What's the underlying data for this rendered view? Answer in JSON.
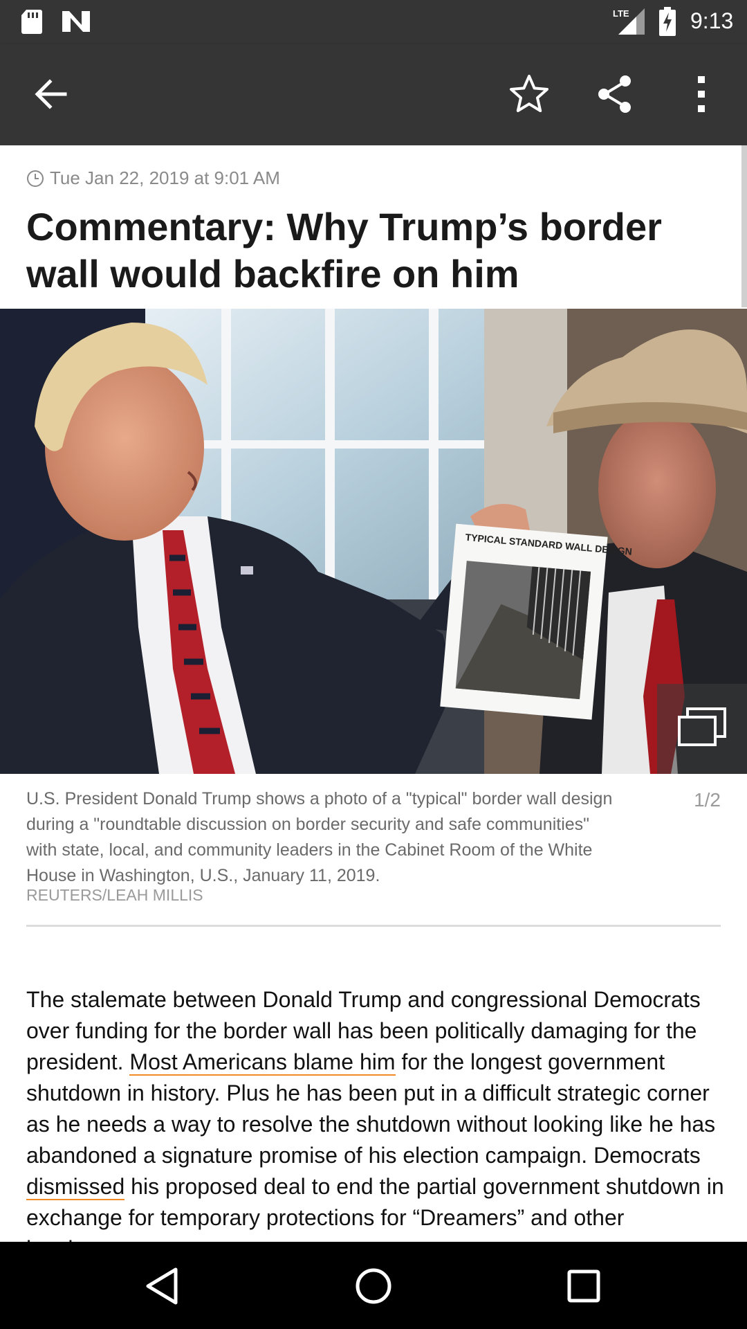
{
  "status_bar": {
    "time": "9:13",
    "network": "LTE"
  },
  "toolbar": {
    "icons": [
      "back-arrow-icon",
      "star-icon",
      "share-icon",
      "more-vert-icon"
    ]
  },
  "article": {
    "date": "Tue Jan 22, 2019 at 9:01 AM",
    "headline": "Commentary: Why Trump’s border wall would backfire on him",
    "photo": {
      "sign_text": "TYPICAL STANDARD WALL DESIGN",
      "counter": "1/2",
      "caption": "U.S. President Donald Trump shows a photo of a \"typical\" border wall design  during a \"roundtable discussion on border security and safe communities\" with state, local, and community leaders in the Cabinet Room of the White House in Washington, U.S., January 11, 2019.",
      "credit": "REUTERS/LEAH MILLIS"
    },
    "body": {
      "p1": "The stalemate between Donald Trump and congressional Democrats over funding for the border wall has been politically damaging for the president. ",
      "link1": "Most Americans blame him",
      "p2": " for the longest government shutdown in history. Plus he has been put in a difficult strategic corner as he needs a way to resolve the shutdown without looking like he has abandoned a signature promise of his election campaign. Democrats ",
      "link2": "dismissed",
      "p3": " his proposed deal to end the partial government shutdown in exchange for temporary protections for “Dreamers” and other immigrants"
    }
  },
  "colors": {
    "bar": "#353535",
    "link_underline": "#f08a24"
  }
}
